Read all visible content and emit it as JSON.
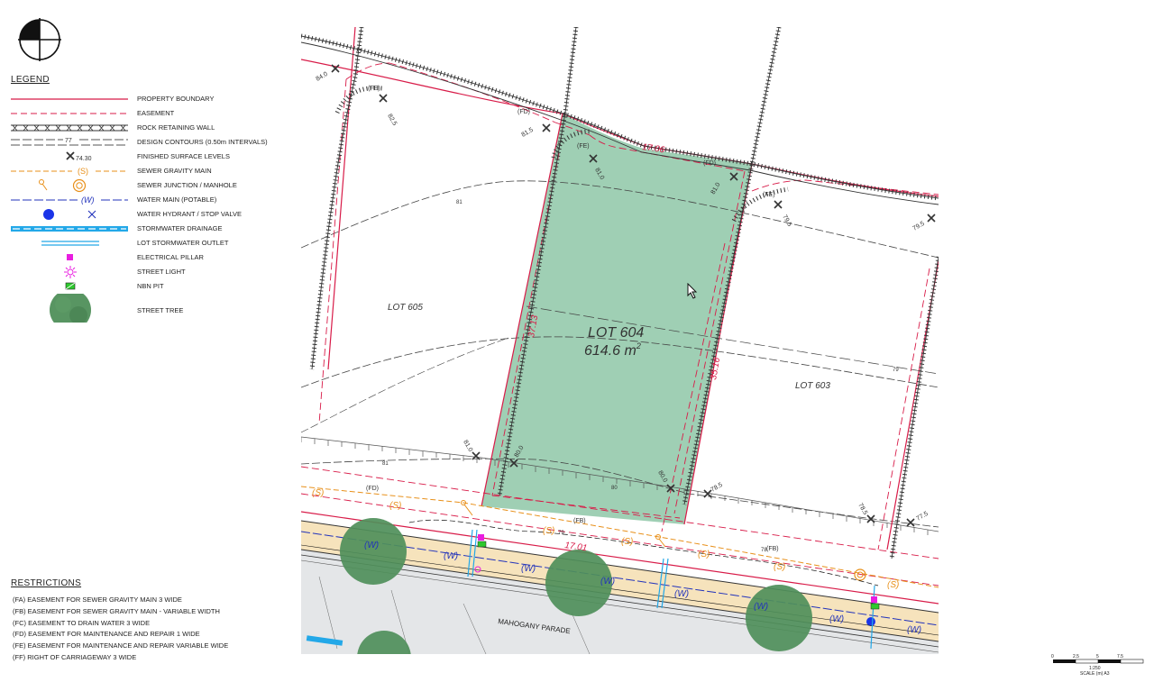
{
  "legend": {
    "title": "LEGEND",
    "items": [
      {
        "label": "PROPERTY BOUNDARY",
        "symbol": "property-boundary"
      },
      {
        "label": "EASEMENT",
        "symbol": "easement"
      },
      {
        "label": "ROCK RETAINING WALL",
        "symbol": "rock-retaining-wall"
      },
      {
        "label": "DESIGN CONTOURS (0.50m INTERVALS)",
        "symbol": "design-contours",
        "sample": "77"
      },
      {
        "label": "FINISHED SURFACE LEVELS",
        "symbol": "finished-surface-levels",
        "sample": "74.30"
      },
      {
        "label": "SEWER GRAVITY MAIN",
        "symbol": "sewer-gravity-main",
        "sample": "(S)"
      },
      {
        "label": "SEWER JUNCTION / MANHOLE",
        "symbol": "sewer-junction-manhole"
      },
      {
        "label": "WATER MAIN (POTABLE)",
        "symbol": "water-main",
        "sample": "(W)"
      },
      {
        "label": "WATER HYDRANT / STOP VALVE",
        "symbol": "hydrant-stop-valve"
      },
      {
        "label": "STORMWATER DRAINAGE",
        "symbol": "stormwater-drainage"
      },
      {
        "label": "LOT STORMWATER OUTLET",
        "symbol": "lot-stormwater-outlet"
      },
      {
        "label": "ELECTRICAL PILLAR",
        "symbol": "electrical-pillar"
      },
      {
        "label": "STREET LIGHT",
        "symbol": "street-light"
      },
      {
        "label": "NBN PIT",
        "symbol": "nbn-pit"
      },
      {
        "label": "STREET TREE",
        "symbol": "street-tree"
      }
    ]
  },
  "restrictions": {
    "title": "RESTRICTIONS",
    "items": [
      "(FA) EASEMENT FOR SEWER GRAVITY MAIN 3 WIDE",
      "(FB) EASEMENT FOR SEWER GRAVITY MAIN - VARIABLE WIDTH",
      "(FC) EASEMENT TO DRAIN WATER 3 WIDE",
      "(FD) EASEMENT FOR MAINTENANCE AND REPAIR 1 WIDE",
      "(FE) EASEMENT FOR MAINTENANCE AND REPAIR VARIABLE WIDE",
      "(FF) RIGHT OF CARRIAGEWAY 3 WIDE"
    ]
  },
  "map": {
    "main_lot": {
      "name": "LOT 604",
      "area": "614.6 m",
      "area_sup": "2"
    },
    "lots": [
      "LOT 605",
      "LOT 603"
    ],
    "road": "MAHOGANY PARADE",
    "dimensions": [
      "17.06",
      "37.13",
      "35.16",
      "17.01"
    ],
    "levels": [
      "84.0",
      "82.5",
      "81.5",
      "81.0",
      "81.0",
      "79.5",
      "79.5",
      "81.0",
      "80.0",
      "80.0",
      "78.5",
      "78.5",
      "77.5"
    ],
    "contours": [
      "81",
      "81",
      "79",
      "80",
      "79",
      "78"
    ],
    "easement_tags": [
      "(FE)",
      "(FD)",
      "(FB)"
    ],
    "utility_tags": {
      "sewer": "(S)",
      "water": "(W)"
    },
    "colors": {
      "lot_fill": "#9fcfb4",
      "boundary": "#d81b48",
      "sewer": "#e8901a",
      "water": "#2233bb",
      "road_verge": "#f6e3bc",
      "road": "#e4e6e8",
      "tree": "#4f8f5a",
      "pillar": "#e91ee0",
      "nbn": "#2ec92e"
    }
  },
  "scale": {
    "ticks": [
      "0",
      "2.5",
      "5",
      "7.5"
    ],
    "caption": "1:250",
    "units": "SCALE (m) A3"
  }
}
